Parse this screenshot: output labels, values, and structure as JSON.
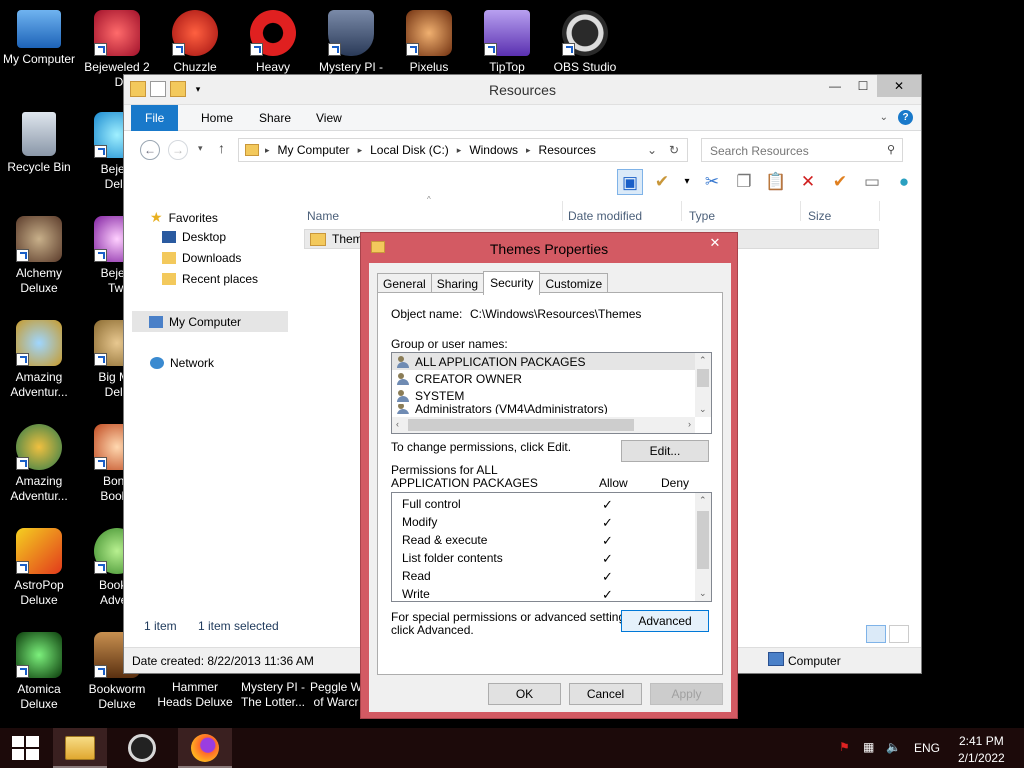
{
  "desktop": {
    "icons": [
      {
        "label": "My Computer"
      },
      {
        "label": "Bejeweled 2"
      },
      {
        "label": "Delu"
      },
      {
        "label": "Chuzzle"
      },
      {
        "label": "Heavy"
      },
      {
        "label": "Mystery PI -"
      },
      {
        "label": "Pixelus Deluxe"
      },
      {
        "label": "TipTop"
      },
      {
        "label": "OBS Studio"
      },
      {
        "label": "Recycle Bin"
      },
      {
        "label": "Bejew"
      },
      {
        "label": "Delu"
      },
      {
        "label": "Alchemy"
      },
      {
        "label": "Deluxe"
      },
      {
        "label": "Bejew"
      },
      {
        "label": "Twi"
      },
      {
        "label": "Amazing"
      },
      {
        "label": "Adventur..."
      },
      {
        "label": "Big Mo"
      },
      {
        "label": "Delu"
      },
      {
        "label": "Amazing"
      },
      {
        "label": "Adventur..."
      },
      {
        "label": "Bonn"
      },
      {
        "label": "Books"
      },
      {
        "label": "AstroPop"
      },
      {
        "label": "Deluxe"
      },
      {
        "label": "Bookw"
      },
      {
        "label": "Adven"
      },
      {
        "label": "Atomica"
      },
      {
        "label": "Deluxe"
      },
      {
        "label": "Bookworm"
      },
      {
        "label": "Deluxe"
      },
      {
        "label": "Hammer"
      },
      {
        "label": "Heads Deluxe"
      },
      {
        "label": "Mystery PI -"
      },
      {
        "label": "The Lotter..."
      },
      {
        "label": "Peggle W"
      },
      {
        "label": "of Warcr"
      }
    ]
  },
  "explorer": {
    "title": "Resources",
    "tabs": {
      "file": "File",
      "home": "Home",
      "share": "Share",
      "view": "View"
    },
    "address": {
      "c1": "My Computer",
      "c2": "Local Disk (C:)",
      "c3": "Windows",
      "c4": "Resources"
    },
    "search_placeholder": "Search Resources",
    "nav": {
      "favorites": "Favorites",
      "desktop": "Desktop",
      "downloads": "Downloads",
      "recent": "Recent places",
      "mycomputer": "My Computer",
      "network": "Network"
    },
    "columns": {
      "name": "Name",
      "date": "Date modified",
      "type": "Type",
      "size": "Size"
    },
    "file_name": "Theme",
    "status": {
      "count": "1 item",
      "selected": "1 item selected"
    },
    "details": {
      "created": "Date created: 8/22/2013 11:36 AM",
      "location": "Computer"
    }
  },
  "dialog": {
    "title": "Themes Properties",
    "close": "✕",
    "tabs": {
      "general": "General",
      "sharing": "Sharing",
      "security": "Security",
      "customize": "Customize"
    },
    "object_label": "Object name:",
    "object_value": "C:\\Windows\\Resources\\Themes",
    "group_label": "Group or user names:",
    "groups": [
      "ALL APPLICATION PACKAGES",
      "CREATOR OWNER",
      "SYSTEM",
      "Administrators (VM4\\Administrators)"
    ],
    "change_text": "To change permissions, click Edit.",
    "edit_button": "Edit...",
    "perm_label1": "Permissions for ALL",
    "perm_label2": "APPLICATION PACKAGES",
    "allow": "Allow",
    "deny": "Deny",
    "permissions": [
      {
        "name": "Full control",
        "allow": "✓"
      },
      {
        "name": "Modify",
        "allow": "✓"
      },
      {
        "name": "Read & execute",
        "allow": "✓"
      },
      {
        "name": "List folder contents",
        "allow": "✓"
      },
      {
        "name": "Read",
        "allow": "✓"
      },
      {
        "name": "Write",
        "allow": "✓"
      }
    ],
    "special_text1": "For special permissions or advanced settings,",
    "special_text2": "click Advanced.",
    "advanced_button": "Advanced",
    "ok": "OK",
    "cancel": "Cancel",
    "apply": "Apply"
  },
  "taskbar": {
    "lang": "ENG",
    "time": "2:41 PM",
    "date": "2/1/2022"
  },
  "colors": {
    "dialog_frame": "#d35a63",
    "file_tab": "#1979ca",
    "taskbar": "#1c0a0a"
  }
}
